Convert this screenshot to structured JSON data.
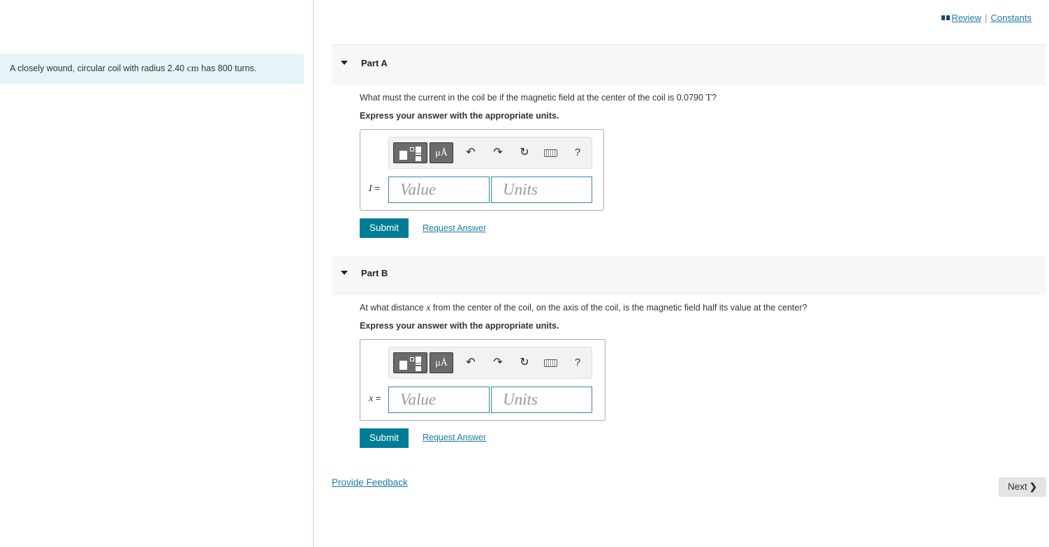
{
  "topbar": {
    "review": "Review",
    "separator": "|",
    "constants": "Constants"
  },
  "intro": {
    "before": "A closely wound, circular coil with radius 2.40 ",
    "unit": "cm",
    "after": " has 800 turns."
  },
  "parts": [
    {
      "title": "Part A",
      "question_before": "What must the current in the coil be if the magnetic field at the center of the coil is 0.0790 ",
      "question_unit": "T",
      "question_after": "?",
      "express": "Express your answer with the appropriate units.",
      "variable": "I",
      "equals": " =",
      "value_placeholder": "Value",
      "units_placeholder": "Units",
      "submit": "Submit",
      "request_answer": "Request Answer"
    },
    {
      "title": "Part B",
      "question_before": "At what distance ",
      "question_var": "x",
      "question_after": " from the center of the coil, on the axis of the coil, is the magnetic field half its value at the center?",
      "express": "Express your answer with the appropriate units.",
      "variable": "x",
      "equals": " =",
      "value_placeholder": "Value",
      "units_placeholder": "Units",
      "submit": "Submit",
      "request_answer": "Request Answer"
    }
  ],
  "toolbar": {
    "mu_label": "μÅ",
    "undo": "↶",
    "redo": "↷",
    "reset": "↻",
    "help": "?",
    "icons": [
      "templates-icon",
      "units-icon",
      "undo-icon",
      "redo-icon",
      "reset-icon",
      "keyboard-icon",
      "help-icon"
    ]
  },
  "footer": {
    "feedback": "Provide Feedback",
    "next": "Next",
    "next_chevron": "❯"
  }
}
